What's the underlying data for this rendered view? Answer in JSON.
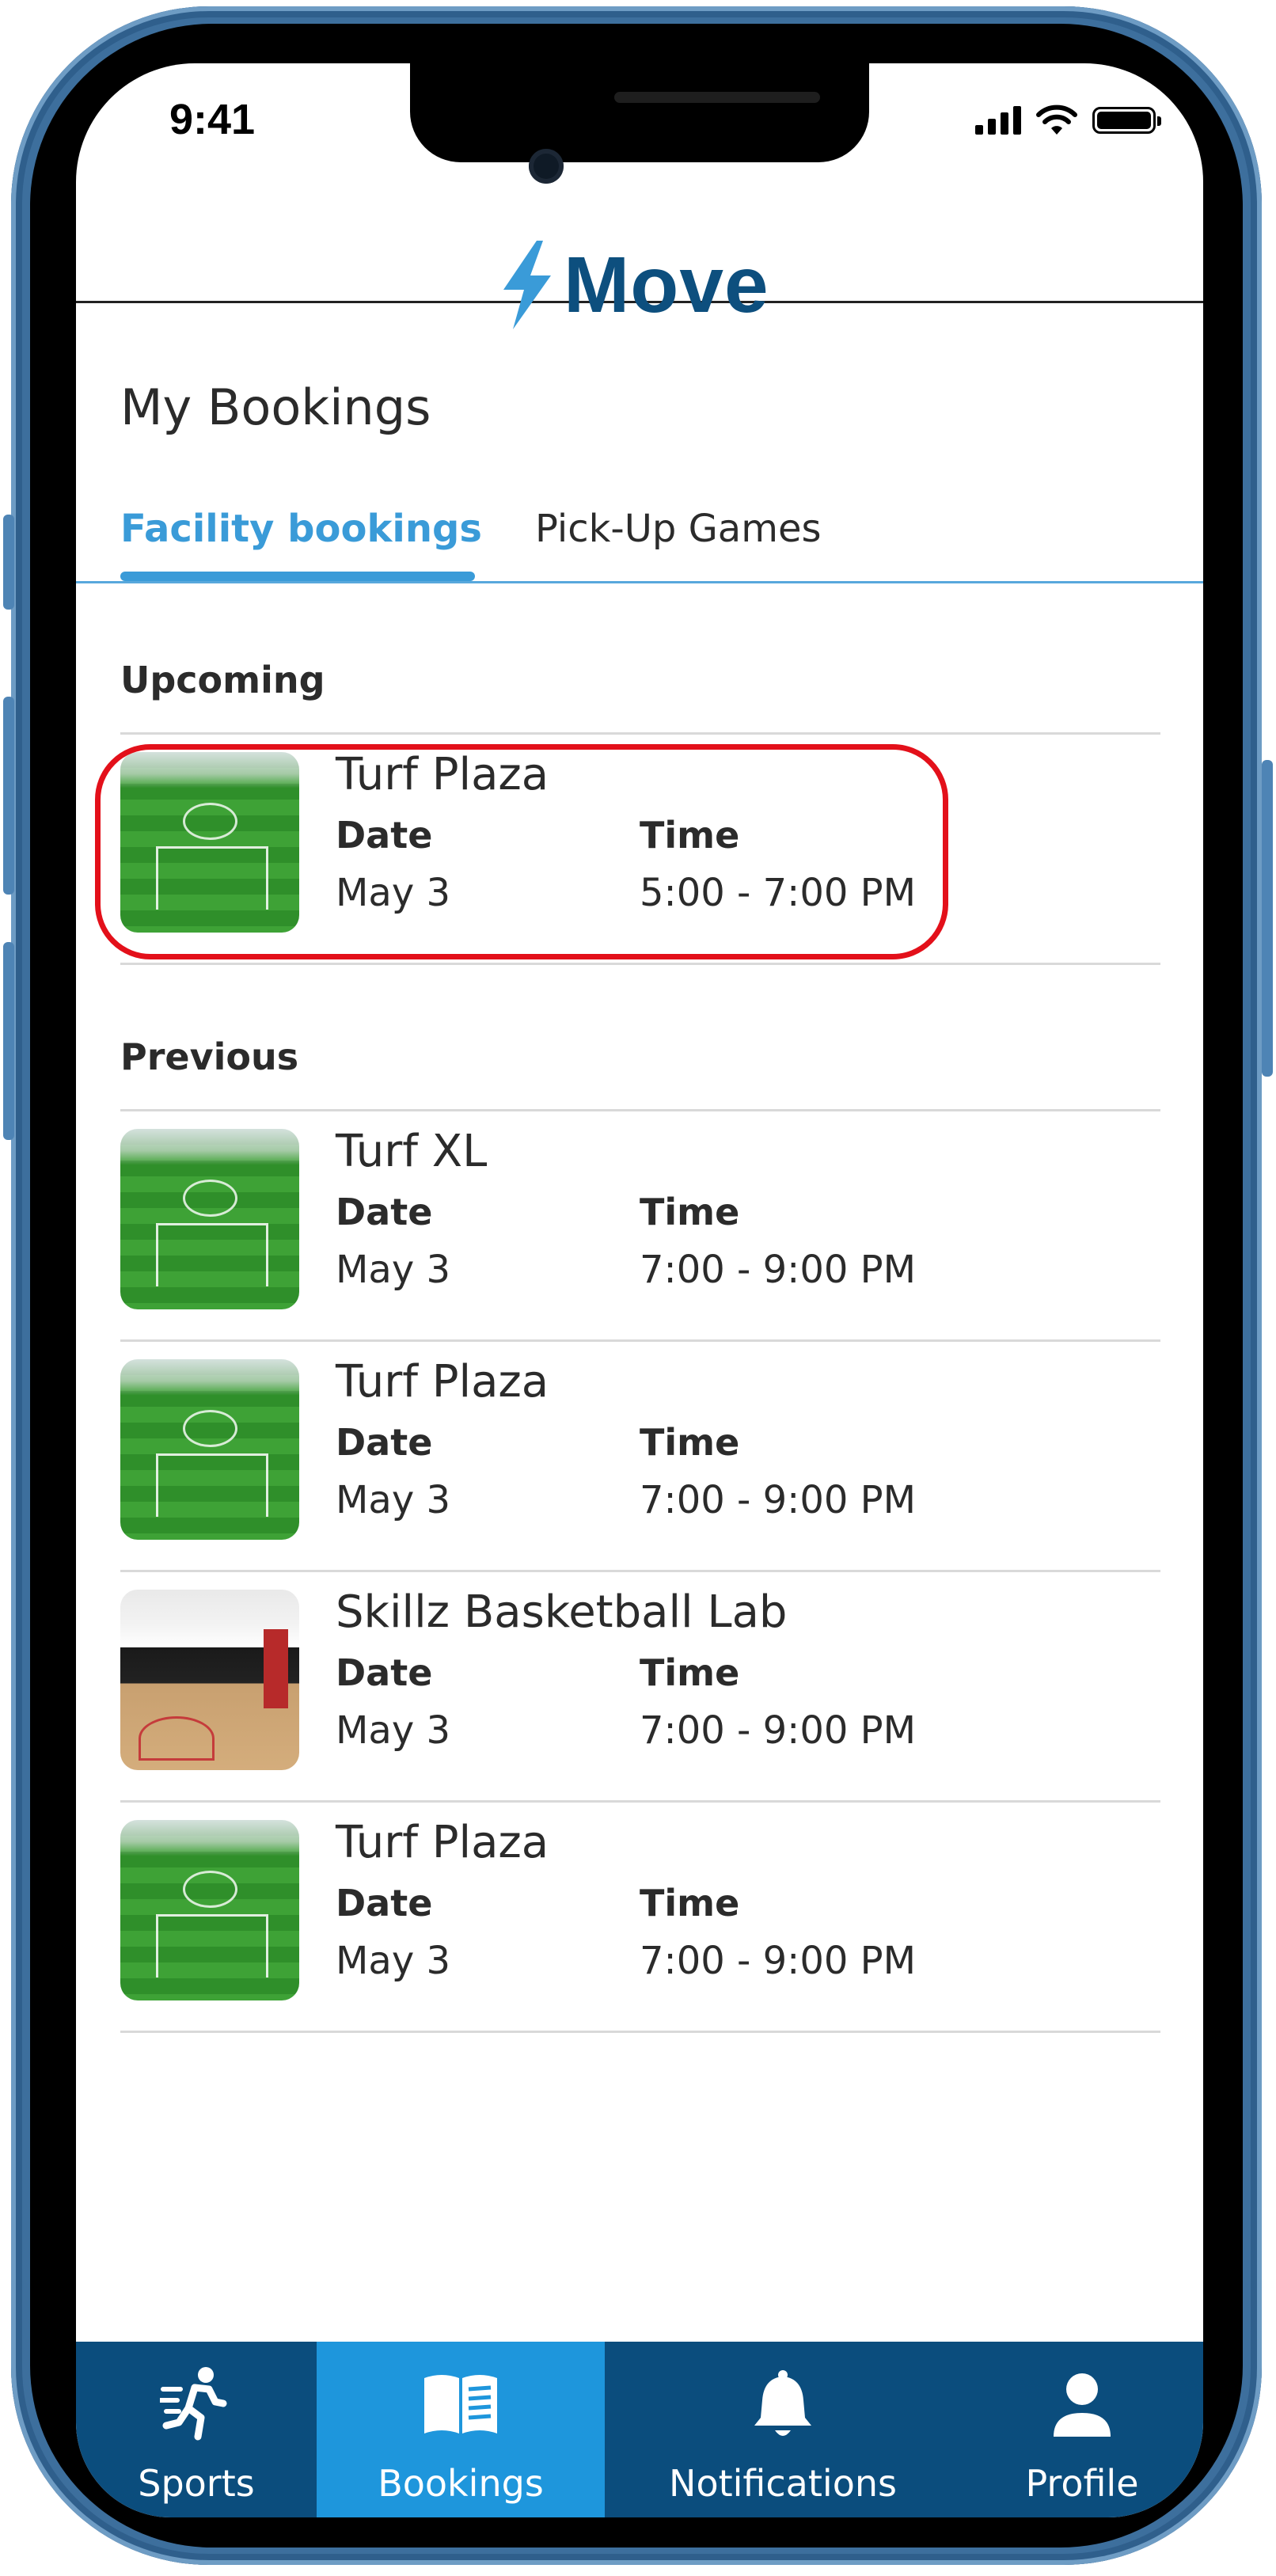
{
  "status_bar": {
    "time": "9:41"
  },
  "app": {
    "name": "Move"
  },
  "page": {
    "title": "My Bookings"
  },
  "tabs": [
    {
      "label": "Facility bookings",
      "active": true
    },
    {
      "label": "Pick-Up Games",
      "active": false
    }
  ],
  "sections": {
    "upcoming_label": "Upcoming",
    "previous_label": "Previous"
  },
  "upcoming": [
    {
      "venue": "Turf Plaza",
      "date_label": "Date",
      "time_label": "Time",
      "date": "May 3",
      "time": "5:00 - 7:00 PM",
      "thumbnail": "turf-field"
    }
  ],
  "previous": [
    {
      "venue": "Turf XL",
      "date_label": "Date",
      "time_label": "Time",
      "date": "May 3",
      "time": "7:00 - 9:00 PM",
      "thumbnail": "turf-field"
    },
    {
      "venue": "Turf Plaza",
      "date_label": "Date",
      "time_label": "Time",
      "date": "May 3",
      "time": "7:00 - 9:00 PM",
      "thumbnail": "turf-field"
    },
    {
      "venue": "Skillz Basketball Lab",
      "date_label": "Date",
      "time_label": "Time",
      "date": "May 3",
      "time": "7:00 - 9:00 PM",
      "thumbnail": "basketball-court"
    },
    {
      "venue": "Turf Plaza",
      "date_label": "Date",
      "time_label": "Time",
      "date": "May 3",
      "time": "7:00 - 9:00 PM",
      "thumbnail": "turf-field"
    }
  ],
  "bottom_nav": [
    {
      "label": "Sports",
      "icon": "running-person-icon",
      "active": false
    },
    {
      "label": "Bookings",
      "icon": "open-book-icon",
      "active": true
    },
    {
      "label": "Notifications",
      "icon": "bell-icon",
      "active": false
    },
    {
      "label": "Profile",
      "icon": "person-icon",
      "active": false
    }
  ],
  "colors": {
    "brand_dark": "#0d4f7e",
    "accent": "#3a9bd8",
    "nav_bg": "#0b4d7d",
    "nav_active": "#1e96dc",
    "highlight": "#e3101a"
  }
}
